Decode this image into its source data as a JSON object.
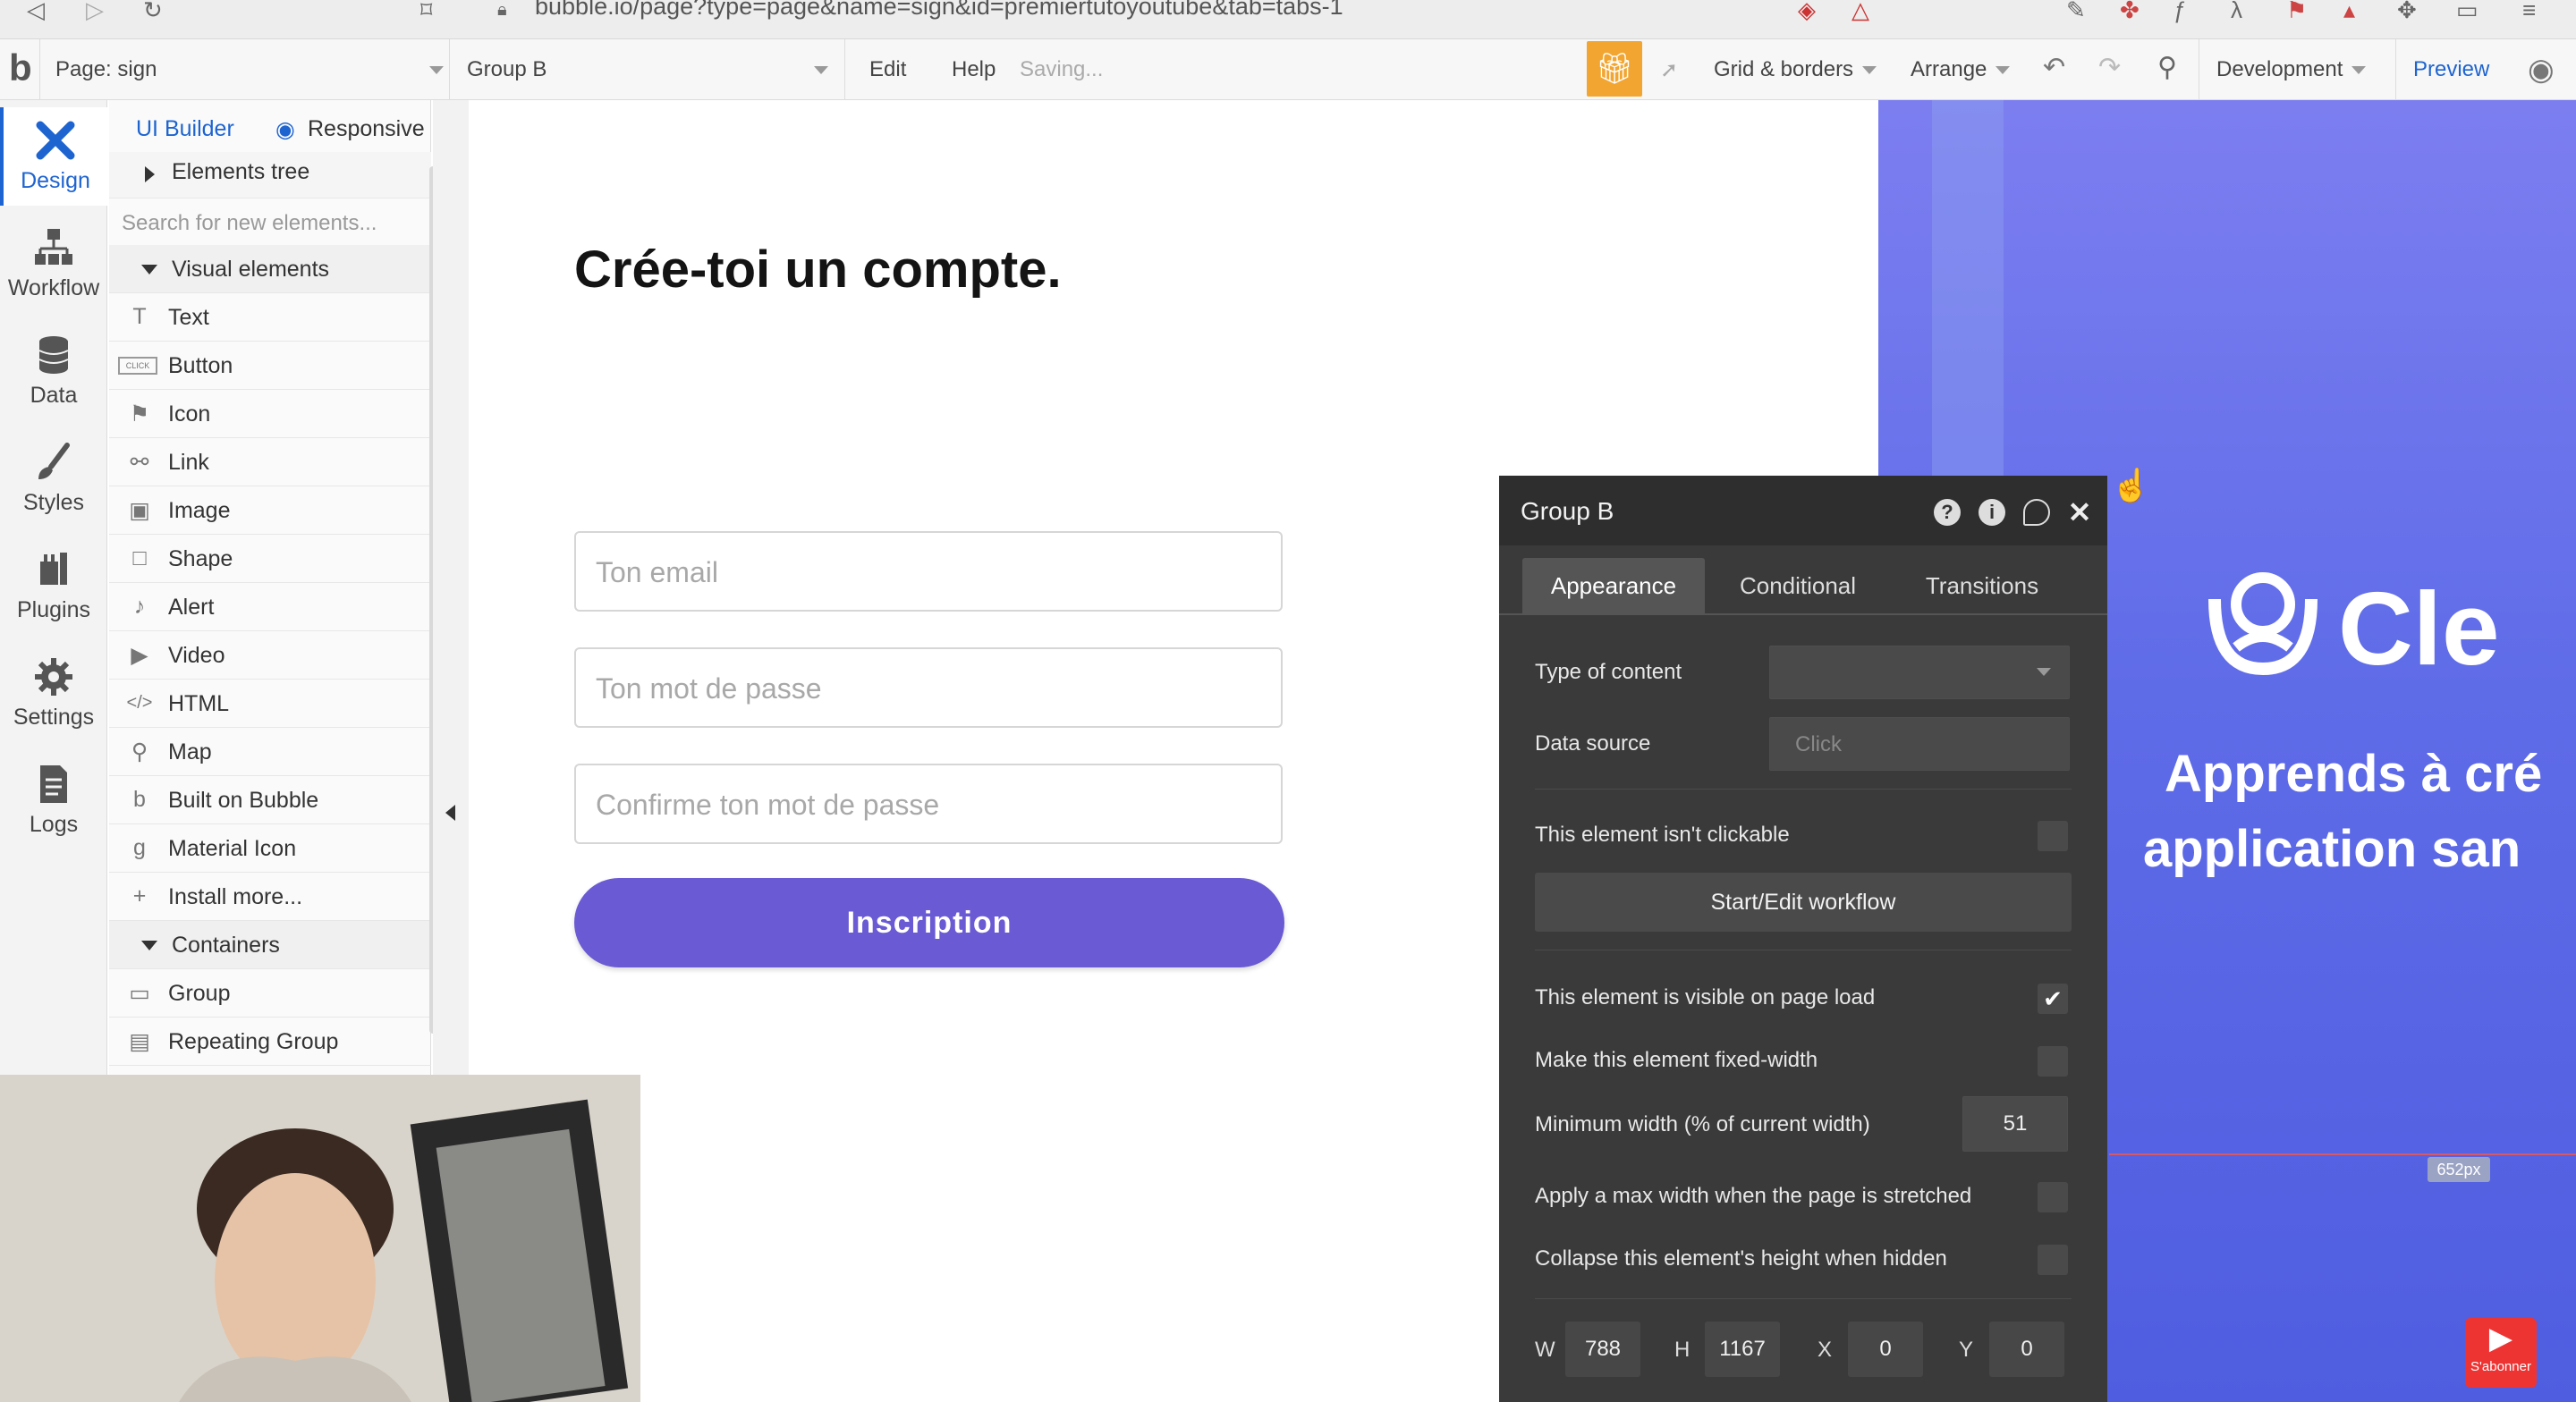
{
  "browser": {
    "url": "bubble.io/page?type=page&name=sign&id=premiertutoyoutube&tab=tabs-1"
  },
  "topbar": {
    "page_label": "Page: sign",
    "element_select": "Group B",
    "edit": "Edit",
    "help": "Help",
    "status": "Saving...",
    "grid": "Grid & borders",
    "arrange": "Arrange",
    "development": "Development",
    "preview": "Preview"
  },
  "sidebar": {
    "tools": [
      {
        "label": "Design",
        "icon": "design-icon"
      },
      {
        "label": "Workflow",
        "icon": "workflow-icon"
      },
      {
        "label": "Data",
        "icon": "data-icon"
      },
      {
        "label": "Styles",
        "icon": "styles-icon"
      },
      {
        "label": "Plugins",
        "icon": "plugins-icon"
      },
      {
        "label": "Settings",
        "icon": "settings-icon"
      },
      {
        "label": "Logs",
        "icon": "logs-icon"
      }
    ]
  },
  "panel": {
    "tab_ui": "UI Builder",
    "tab_responsive": "Responsive",
    "elements_tree": "Elements tree",
    "search_placeholder": "Search for new elements...",
    "visual_section": "Visual elements",
    "visual_items": [
      {
        "label": "Text",
        "icon": "T"
      },
      {
        "label": "Button",
        "icon": "CLICK"
      },
      {
        "label": "Icon",
        "icon": "⚑"
      },
      {
        "label": "Link",
        "icon": "⚯"
      },
      {
        "label": "Image",
        "icon": "▣"
      },
      {
        "label": "Shape",
        "icon": "□"
      },
      {
        "label": "Alert",
        "icon": "♪"
      },
      {
        "label": "Video",
        "icon": "▶"
      },
      {
        "label": "HTML",
        "icon": "</>"
      },
      {
        "label": "Map",
        "icon": "⚲"
      },
      {
        "label": "Built on Bubble",
        "icon": "b"
      },
      {
        "label": "Material Icon",
        "icon": "g"
      },
      {
        "label": "Install more...",
        "icon": "+"
      }
    ],
    "containers_section": "Containers",
    "container_items": [
      {
        "label": "Group",
        "icon": "▭"
      },
      {
        "label": "Repeating Group",
        "icon": "▤"
      }
    ]
  },
  "canvas": {
    "heading": "Crée-toi un compte.",
    "email_placeholder": "Ton email",
    "password_placeholder": "Ton mot de passe",
    "confirm_placeholder": "Confirme ton mot de passe",
    "button": "Inscription",
    "brand_text": "Cle",
    "tagline_1": "Apprends à cré",
    "tagline_2": "application san",
    "px_badge": "652px",
    "youtube_label": "S'abonner"
  },
  "property_panel": {
    "title": "Group B",
    "tabs": [
      "Appearance",
      "Conditional",
      "Transitions"
    ],
    "type_of_content": "Type of content",
    "data_source": "Data source",
    "data_source_value": "Click",
    "not_clickable": "This element isn't clickable",
    "workflow_button": "Start/Edit workflow",
    "visible_on_load": "This element is visible on page load",
    "visible_checked": true,
    "fixed_width": "Make this element fixed-width",
    "min_width": "Minimum width (% of current width)",
    "min_width_value": "51",
    "max_width": "Apply a max width when the page is stretched",
    "collapse": "Collapse this element's height when hidden",
    "w_label": "W",
    "w": "788",
    "h_label": "H",
    "h": "1167",
    "x_label": "X",
    "x": "0",
    "y_label": "Y",
    "y": "0"
  },
  "colors": {
    "accent_blue": "#1e64d0",
    "button_purple": "#6a5ad3",
    "gift_orange": "#f2a531",
    "panel_dark": "#3a3a3a"
  }
}
